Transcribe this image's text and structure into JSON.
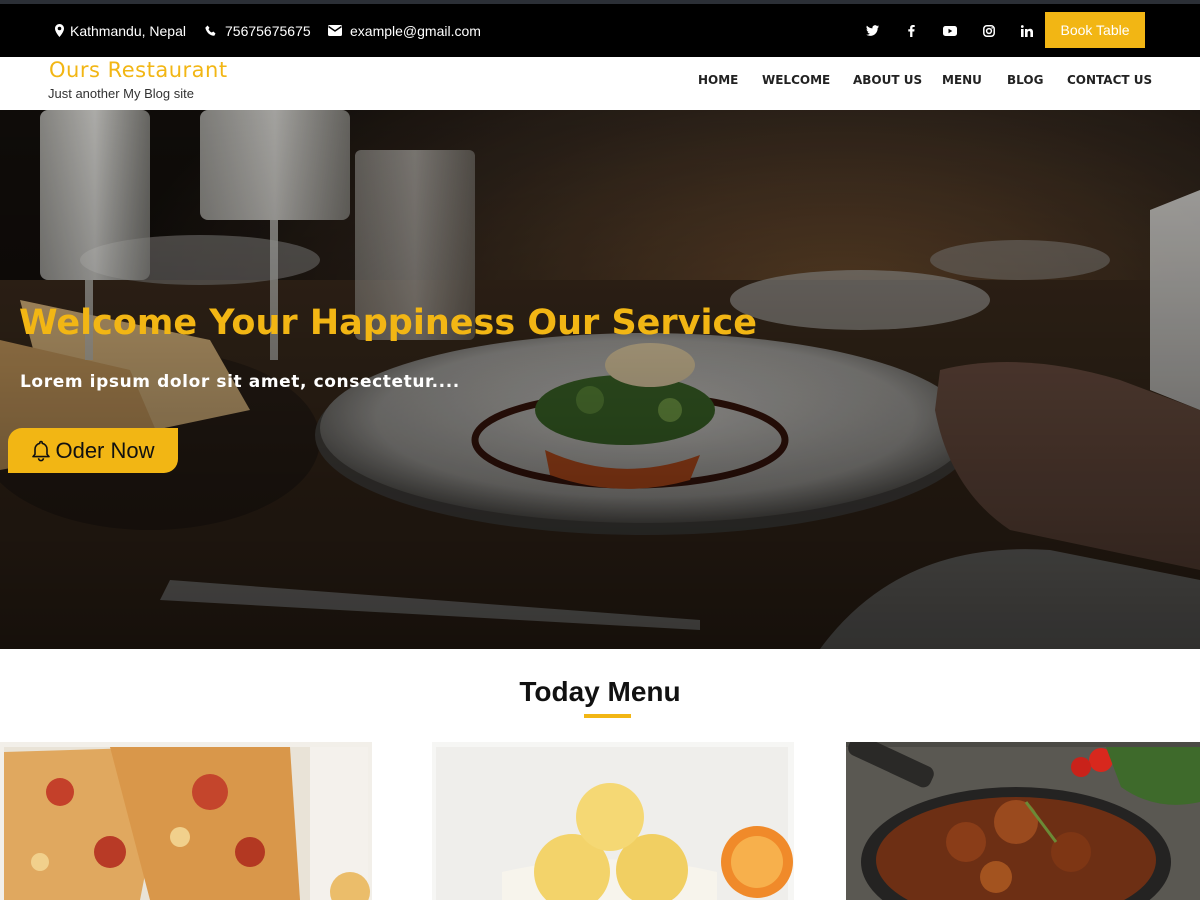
{
  "topbar": {
    "location": "Kathmandu, Nepal",
    "phone": "75675675675",
    "email": "example@gmail.com",
    "social_icons": [
      "twitter-icon",
      "facebook-icon",
      "youtube-icon",
      "instagram-icon",
      "linkedin-icon"
    ],
    "book_label": "Book Table"
  },
  "header": {
    "site_title": "Ours Restaurant",
    "tagline": "Just another My Blog site",
    "nav": [
      "HOME",
      "WELCOME",
      "ABOUT US",
      "MENU",
      "BLOG",
      "CONTACT US"
    ]
  },
  "hero": {
    "title": "Welcome Your Happiness Our Service",
    "subtitle": "Lorem ipsum dolor sit amet, consectetur....",
    "button_label": "Oder Now",
    "button_icon": "bell-icon"
  },
  "menu_section": {
    "title": "Today Menu",
    "cards": [
      "pizza-image",
      "ice-cream-image",
      "beef-stew-image"
    ]
  },
  "colors": {
    "accent": "#f2b614",
    "topbar_bg": "#000000",
    "text_dark": "#222222"
  }
}
